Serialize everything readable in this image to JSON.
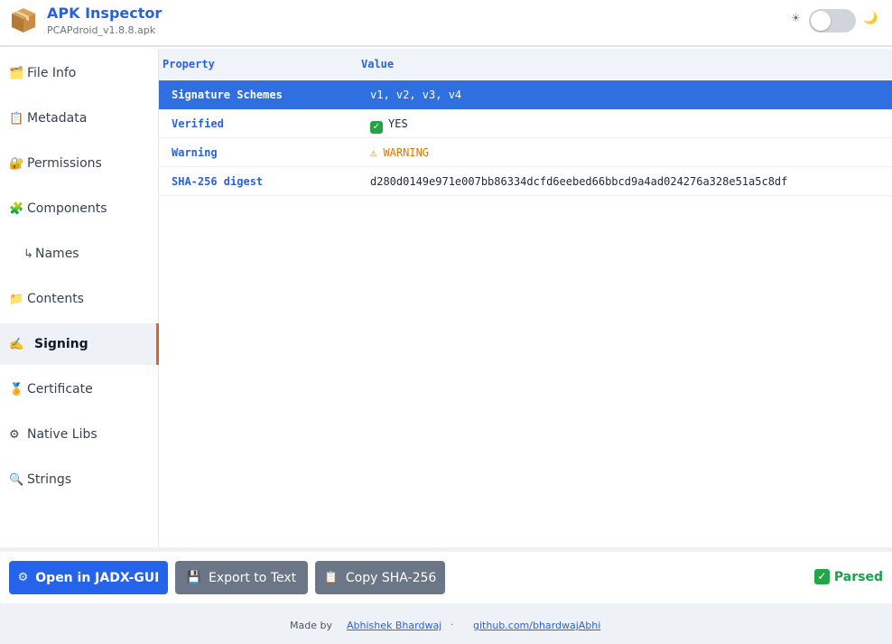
{
  "header": {
    "app_icon": "package-box-icon",
    "title": "APK Inspector",
    "subtitle": "PCAPdroid_v1.8.8.apk",
    "theme_toggle": {
      "sun_icon": "☀",
      "moon_icon": "🌙",
      "dark_mode": false
    }
  },
  "sidebar": {
    "items": [
      {
        "icon": "🗂️",
        "label": "File Info"
      },
      {
        "icon": "📋",
        "label": "Metadata"
      },
      {
        "icon": "🔐",
        "label": "Permissions"
      },
      {
        "icon": "🧩",
        "label": "Components"
      },
      {
        "icon": "↳",
        "label": "Names"
      },
      {
        "icon": "📁",
        "label": "Contents"
      },
      {
        "icon": "✍️",
        "label": "Signing",
        "active": true
      },
      {
        "icon": "🏅",
        "label": "Certificate"
      },
      {
        "icon": "⚙",
        "label": "Native Libs"
      },
      {
        "icon": "🔍",
        "label": "Strings"
      }
    ],
    "active_accent": "#e0642a"
  },
  "table": {
    "columns": [
      "Property",
      "Value"
    ],
    "rows": [
      {
        "key": "Signature Schemes",
        "value": "v1, v2, v3, v4",
        "selected": true
      },
      {
        "key": "Verified",
        "value": "YES",
        "icon": "check-icon"
      },
      {
        "key": "Warning",
        "value": "⚠ WARNING",
        "status": "warning"
      },
      {
        "key": "SHA-256 digest",
        "value": "d280d0149e971e007bb86334dcfd6eebed66bbcd9a4ad024276a328e51a5c8df"
      }
    ]
  },
  "actions": {
    "open_jadx": {
      "icon": "⚙",
      "label": "Open in JADX-GUI"
    },
    "export_text": {
      "icon": "💾",
      "label": "Export to Text"
    },
    "copy_sha": {
      "icon": "📋",
      "label": "Copy SHA-256"
    },
    "status": "Parsed"
  },
  "credits": {
    "made_by": "Made by",
    "author": "Abhishek Bhardwaj",
    "separator": "·",
    "github": "github.com/bhardwajAbhi"
  },
  "colors": {
    "accent": "#2563eb",
    "selected_row": "#2f6fe0",
    "success": "#16a34a",
    "warning": "#d97706",
    "secondary_button": "#6b7686"
  }
}
